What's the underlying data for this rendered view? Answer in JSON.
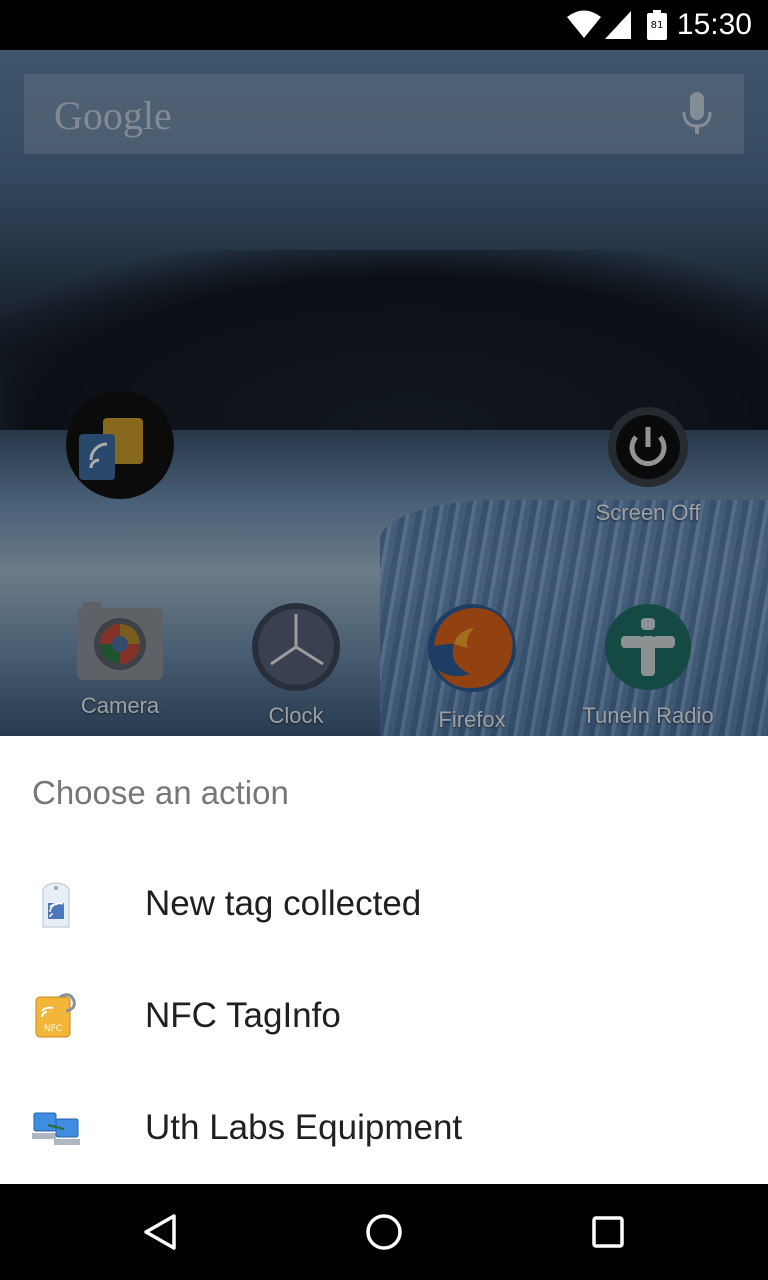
{
  "status_bar": {
    "time": "15:30",
    "battery_level": "81",
    "icons": [
      "wifi-icon",
      "signal-icon",
      "battery-icon"
    ]
  },
  "home": {
    "search_logo": "Google",
    "apps_row_top": [
      {
        "name": "nfc-app",
        "label": ""
      },
      {
        "name": "screen-off",
        "label": "Screen Off"
      }
    ],
    "apps_row_bottom": [
      {
        "name": "camera",
        "label": "Camera"
      },
      {
        "name": "clock",
        "label": "Clock"
      },
      {
        "name": "firefox",
        "label": "Firefox"
      },
      {
        "name": "tunein-radio",
        "label": "TuneIn Radio"
      }
    ]
  },
  "chooser": {
    "title": "Choose an action",
    "options": [
      {
        "label": "New tag collected",
        "icon": "tag-collected-icon"
      },
      {
        "label": "NFC TagInfo",
        "icon": "nfc-taginfo-icon"
      },
      {
        "label": "Uth Labs Equipment",
        "icon": "computers-icon"
      }
    ]
  },
  "nav_bar": {
    "buttons": [
      "back-icon",
      "home-icon",
      "recents-icon"
    ]
  }
}
